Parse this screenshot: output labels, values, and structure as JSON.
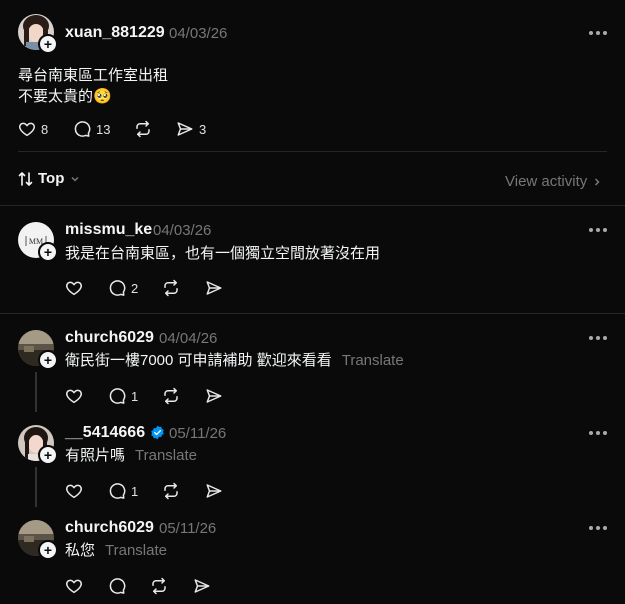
{
  "post": {
    "username": "xuan_881229",
    "date": "04/03/26",
    "lines": [
      "尋台南東區工作室出租",
      "不要太貴的🥺"
    ],
    "likes": "8",
    "comments": "13",
    "shares": "3"
  },
  "sort": {
    "label": "Top",
    "view_activity": "View activity"
  },
  "replies": [
    {
      "username": "missmu_ke",
      "date": "04/03/26",
      "text": "我是在台南東區，也有一個獨立空間放著沒在用",
      "translate": "",
      "comments": "2"
    },
    {
      "username": "church6029",
      "date": "04/04/26",
      "text": "衛民街一樓7000 可申請補助 歡迎來看看",
      "translate": "Translate",
      "comments": "1"
    },
    {
      "username": "__5414666",
      "date": "05/11/26",
      "text": "有照片嗎",
      "translate": "Translate",
      "comments": "1"
    },
    {
      "username": "church6029",
      "date": "05/11/26",
      "text": "私您",
      "translate": "Translate",
      "comments": ""
    }
  ],
  "icons": {
    "heart": "heart-icon",
    "comment": "comment-icon",
    "repost": "repost-icon",
    "share": "share-icon",
    "more": "more-icon",
    "sort": "sort-icon",
    "chevron": "chevron-down-icon",
    "verified": "verified-badge-icon"
  },
  "colors": {
    "background": "#0a0a0a",
    "text": "#f3f5f7",
    "muted": "#777777",
    "verified": "#0095f6"
  }
}
